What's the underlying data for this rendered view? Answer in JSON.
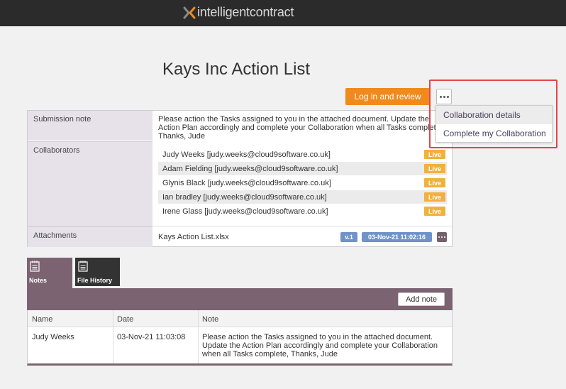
{
  "app": {
    "brand": "intelligentcontract",
    "brand_colors": {
      "topbar": "#2b2b2b",
      "accent": "#f08a1d",
      "purple": "#7b6371"
    }
  },
  "page": {
    "title": "Kays Inc Action List"
  },
  "toolbar": {
    "login_label": "Log in and review",
    "more_icon": "ellipsis-icon"
  },
  "dropdown": {
    "items": [
      {
        "label": "Collaboration details"
      },
      {
        "label": "Complete my Collaboration"
      }
    ]
  },
  "details": {
    "submission_label": "Submission note",
    "submission_text": "Please action the Tasks assigned to you in the attached document. Update the Action Plan accordingly and complete your Collaboration when all Tasks complete, Thanks, Jude",
    "collaborators_label": "Collaborators",
    "collaborators": [
      {
        "name": "Judy Weeks [judy.weeks@cloud9software.co.uk]",
        "status": "Live"
      },
      {
        "name": "Adam Fielding [judy.weeks@cloud9software.co.uk]",
        "status": "Live"
      },
      {
        "name": "Glynis Black [judy.weeks@cloud9software.co.uk]",
        "status": "Live"
      },
      {
        "name": "Ian bradley [judy.weeks@cloud9software.co.uk]",
        "status": "Live"
      },
      {
        "name": "Irene Glass [judy.weeks@cloud9software.co.uk]",
        "status": "Live"
      }
    ],
    "attachments_label": "Attachments",
    "attachment": {
      "name": "Kays Action List.xlsx",
      "version": "v.1",
      "date": "03-Nov-21 11:02:16"
    }
  },
  "tabs": [
    {
      "label": "Notes",
      "icon": "notes-icon"
    },
    {
      "label": "File History",
      "icon": "file-history-icon"
    }
  ],
  "notes": {
    "add_label": "Add note",
    "columns": [
      "Name",
      "Date",
      "Note"
    ],
    "rows": [
      {
        "name": "Judy Weeks",
        "date": "03-Nov-21 11:03:08",
        "note": "Please action the Tasks assigned to you in the attached document. Update the Action Plan accordingly and complete your Collaboration when all Tasks complete, Thanks, Jude"
      }
    ]
  }
}
